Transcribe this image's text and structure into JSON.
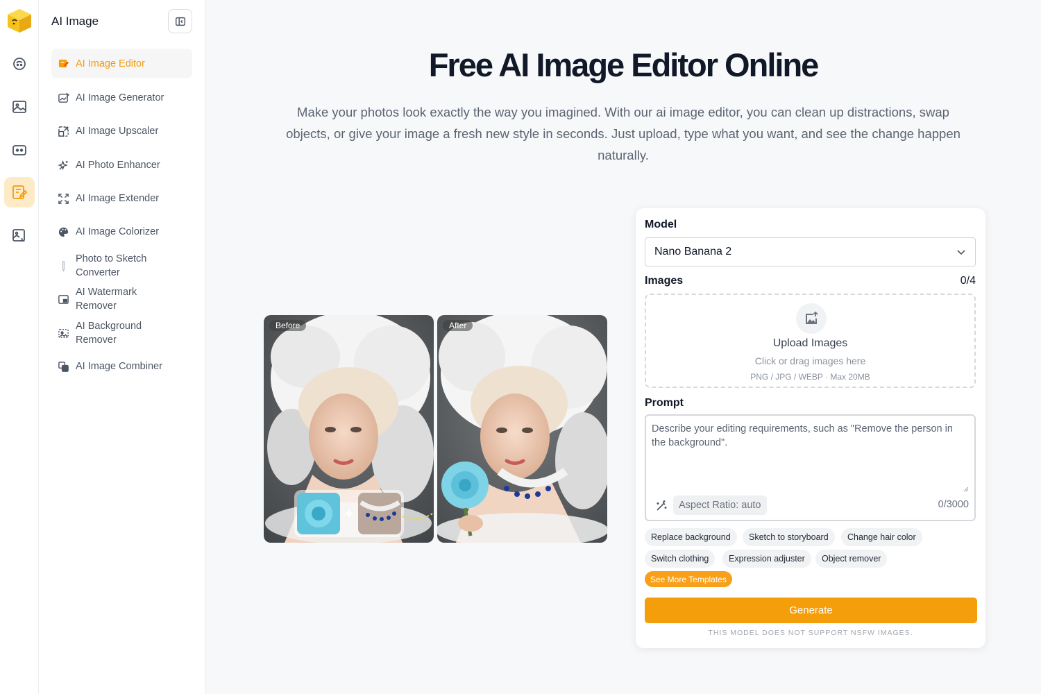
{
  "sidebar": {
    "title": "AI Image",
    "items": [
      {
        "label": "AI Image Editor",
        "icon": "image-edit-icon"
      },
      {
        "label": "AI Image Generator",
        "icon": "image-magic-icon"
      },
      {
        "label": "AI Image Upscaler",
        "icon": "upscale-icon"
      },
      {
        "label": "AI Photo Enhancer",
        "icon": "sparkle-icon"
      },
      {
        "label": "AI Image Extender",
        "icon": "expand-icon"
      },
      {
        "label": "AI Image Colorizer",
        "icon": "palette-icon"
      },
      {
        "label": "Photo to Sketch Converter",
        "icon": "pencil-icon"
      },
      {
        "label": "AI Watermark Remover",
        "icon": "watermark-icon"
      },
      {
        "label": "AI Background Remover",
        "icon": "background-remove-icon"
      },
      {
        "label": "AI Image Combiner",
        "icon": "combine-icon"
      }
    ]
  },
  "hero": {
    "title": "Free AI Image Editor Online",
    "description": "Make your photos look exactly the way you imagined. With our ai image editor, you can clean up distractions, swap objects, or give your image a fresh new style in seconds. Just upload, type what you want, and see the change happen naturally."
  },
  "preview": {
    "before_label": "Before",
    "after_label": "After"
  },
  "form": {
    "model_label": "Model",
    "model_value": "Nano Banana 2",
    "images_label": "Images",
    "images_count": "0/4",
    "upload_title": "Upload Images",
    "upload_hint": "Click or drag images here",
    "upload_formats": "PNG / JPG / WEBP · Max 20MB",
    "prompt_label": "Prompt",
    "prompt_placeholder": "Describe your editing requirements, such as \"Remove the person in the background\".",
    "aspect_ratio": "Aspect Ratio: auto",
    "prompt_count": "0/3000",
    "templates": [
      "Replace background",
      "Sketch to storyboard",
      "Change hair color",
      "Switch clothing",
      "Expression adjuster",
      "Object remover"
    ],
    "more_templates": "See More Templates",
    "generate": "Generate",
    "nsfw_note": "This model does not support NSFW images."
  },
  "colors": {
    "accent": "#f59e0b",
    "accent_soft": "#fdebc8"
  }
}
